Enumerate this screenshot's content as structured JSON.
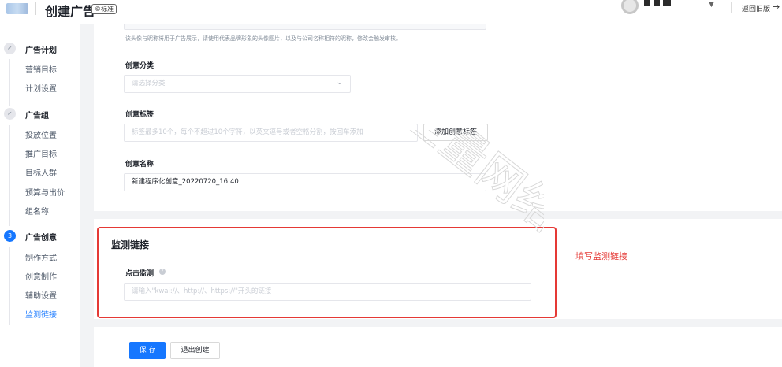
{
  "header": {
    "title": "创建广告",
    "badge": "©标准",
    "back_label": "返回旧版",
    "back_arrow": "→"
  },
  "sidebar": {
    "groups": [
      {
        "step": "✓",
        "title": "广告计划",
        "items": [
          "营销目标",
          "计划设置"
        ]
      },
      {
        "step": "✓",
        "title": "广告组",
        "items": [
          "投放位置",
          "推广目标",
          "目标人群",
          "预算与出价",
          "组名称"
        ]
      },
      {
        "step": "3",
        "title": "广告创意",
        "items": [
          "制作方式",
          "创意制作",
          "辅助设置",
          "监测链接"
        ]
      }
    ],
    "current_item": "监测链接"
  },
  "form": {
    "hint": "该头像与昵称将用于广告展示，请使用代表品牌形象的头像图片，以及与公司名称相符的昵称，修改会触发审核。",
    "category_label": "创意分类",
    "category_placeholder": "请选择分类",
    "tags_label": "创意标签",
    "tags_placeholder": "标签最多10个，每个不超过10个字符，以英文逗号或者空格分割，按回车添加",
    "add_tag_button": "添加创意标签",
    "name_label": "创意名称",
    "name_value": "新建程序化创意_20220720_16:40"
  },
  "monitor": {
    "section_title": "监测链接",
    "click_label": "点击监测",
    "help_icon_glyph": "?",
    "click_placeholder": "请输入\"kwai://、http://、https://\"开头的链接",
    "annotation": "填写监测链接"
  },
  "footer": {
    "save_button": "保 存",
    "exit_button": "退出创建"
  },
  "watermark_text": "巨量网络",
  "colors": {
    "primary": "#1677ff",
    "annotation_red": "#e53935",
    "page_bg": "#f2f3f5"
  },
  "icons": {
    "dropdown": "chevron-down-icon",
    "help": "question-circle-icon",
    "step_done": "check-icon",
    "avatar": "user-avatar-icon"
  }
}
